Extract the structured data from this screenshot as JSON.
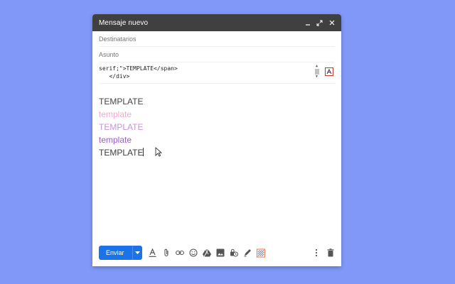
{
  "compose": {
    "title": "Mensaje nuevo",
    "recipients_placeholder": "Destinatarios",
    "subject_placeholder": "Asunto"
  },
  "code": {
    "lines": [
      "serif;\">TEMPLATE</span>",
      "   </div>"
    ]
  },
  "body": {
    "lines": [
      {
        "text": "TEMPLATE",
        "color": "#444444"
      },
      {
        "text": "template",
        "color": "#f0a8d0"
      },
      {
        "text": "TEMPLATE",
        "color": "#c594d6"
      },
      {
        "text": "template",
        "color": "#9b59d0"
      },
      {
        "text": "TEMPLATE",
        "color": "#3c3c3c"
      }
    ]
  },
  "toolbar": {
    "send_label": "Enviar",
    "icons": [
      "format-text-icon",
      "attach-icon",
      "link-icon",
      "emoji-icon",
      "drive-icon",
      "photo-icon",
      "confidential-icon",
      "signature-icon",
      "extension-icon",
      "more-options-icon",
      "trash-icon"
    ]
  },
  "colors": {
    "background": "#8198f9",
    "titlebar": "#404040",
    "send_button": "#1a73e8"
  }
}
